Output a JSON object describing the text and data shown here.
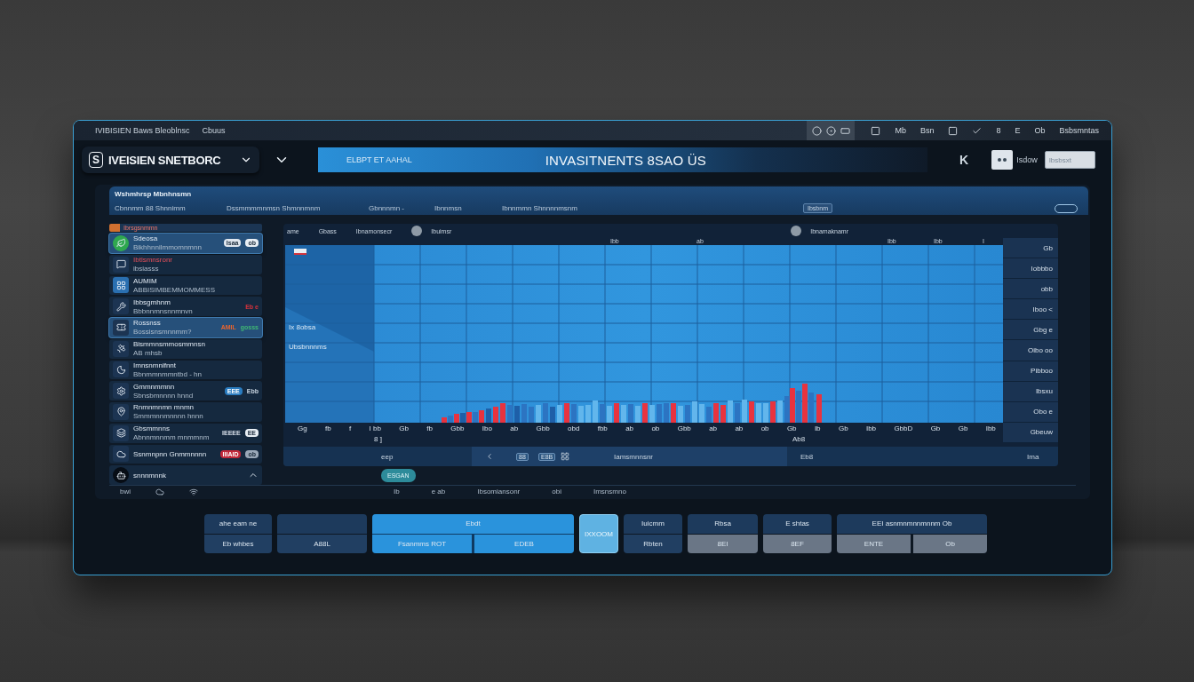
{
  "top_bar": {
    "title": "IVIBISIEN Baws Bleoblnsc",
    "subtitle": "Cbuus",
    "labels": [
      "Mb",
      "Bsn",
      "8",
      "E",
      "Ob",
      "Bsbsmntas"
    ]
  },
  "header": {
    "logo": "S",
    "brand": "IVEISIEN SNETBORC",
    "banner_label": "ELBPT ET AAHAL",
    "title": "INVASITNENTS 8SAO ÜS",
    "shortcut": "K",
    "user_label": "Isdow",
    "search": {
      "value": "Ibsbsxt"
    }
  },
  "sub_bar": {
    "title": "Wshmhrsp Mbnhnsmn",
    "labels": [
      "Cbnnmm 88 Shnnimm",
      "Dssmmmmnmsn Shmnnmnm",
      "Gbnnnmn -",
      "Ibnnmsn",
      "Ibnnmmn Shnnnnmsnm"
    ],
    "chip": "Ibsbnm"
  },
  "sidebar": {
    "header": "Ibrsgsnmmn",
    "items": [
      {
        "kind": "entry",
        "title": "Sdeosa",
        "subtitle": "Bikhhnnilmmomnmnn",
        "selected": true,
        "alert": false,
        "badges": [
          {
            "kind": "pill",
            "text": "Isaa",
            "color": "#dfe6ee"
          },
          {
            "kind": "pill",
            "text": "ob",
            "color": "#e8eef4"
          }
        ]
      },
      {
        "kind": "entry",
        "title": "Ibtlsmnsronr",
        "subtitle": "ibsiasss",
        "selected": false,
        "alert": true
      },
      {
        "kind": "entry",
        "title": "AUMIM",
        "subtitle": "ABBISIMBEMMOMMESS",
        "selected": false,
        "alert": false
      },
      {
        "kind": "entry",
        "title": "Ibbsgmhnm",
        "subtitle": "Bbbnnmnsnnmnvn",
        "selected": false,
        "alert": false,
        "badges": [
          {
            "kind": "text",
            "text": "Eb e",
            "color": "#d8323c"
          }
        ]
      },
      {
        "kind": "entry",
        "title": "Rossnss",
        "subtitle": "Bossisnsmnnmm?",
        "selected": true,
        "alert": false,
        "badges": [
          {
            "kind": "text",
            "text": "AMIL",
            "color": "#e8642e"
          },
          {
            "kind": "text",
            "text": "gosss",
            "color": "#3fb874"
          }
        ]
      },
      {
        "kind": "entry",
        "title": "Bismmnsmmosmmnsn",
        "subtitle": "AB mhsb",
        "selected": false,
        "alert": false
      },
      {
        "kind": "entry",
        "title": "Imnsnmnifnnt",
        "subtitle": "Bbnmmnmmntbd - hn",
        "selected": false,
        "alert": false
      },
      {
        "kind": "entry",
        "title": "Gmmnmmnn",
        "subtitle": "Sbnsbmnnnn hnnd",
        "selected": false,
        "alert": false,
        "badges": [
          {
            "kind": "pill",
            "text": "EEE",
            "color": "#2a7cc0"
          },
          {
            "kind": "text",
            "text": "Ebb",
            "color": "#c8d4e0"
          }
        ]
      },
      {
        "kind": "entry",
        "title": "Rnmnmnmn mnmn",
        "subtitle": "Smmmnnmnnnn hnnn",
        "selected": false,
        "alert": false
      },
      {
        "kind": "entry",
        "title": "Gbsmmnns",
        "subtitle": "Abnnmnnmm mnmmnm",
        "selected": false,
        "alert": false,
        "badges": [
          {
            "kind": "text",
            "text": "IEEEE",
            "color": "#d8e0ea"
          },
          {
            "kind": "pill",
            "text": "EE",
            "color": "#e8eef4"
          }
        ]
      },
      {
        "kind": "entry",
        "title": "Ssnmnpnn Gnmmnnnn",
        "selected": false,
        "alert": false,
        "badges": [
          {
            "kind": "pill",
            "text": "IIIAID",
            "color": "#c0283a"
          },
          {
            "kind": "pill",
            "text": "ob",
            "color": "#9aa8b8"
          }
        ]
      },
      {
        "kind": "group",
        "title": "snnnmnnk",
        "selected": false,
        "alert": false
      }
    ],
    "footer": "bwi"
  },
  "chart": {
    "head": [
      {
        "kind": "plain",
        "text": "ame"
      },
      {
        "kind": "plain",
        "text": "Gbass"
      },
      {
        "kind": "plain",
        "text": "Ibnamonsecr"
      },
      {
        "kind": "dot",
        "text": "Ibuimsr"
      },
      {
        "kind": "dot",
        "text": "Ibnamaknamr"
      }
    ],
    "top_ticks": [
      "Ibb",
      "ab",
      "Ibb",
      "Ibb",
      "I"
    ],
    "notes": [
      "Ix 8obsa",
      "Ubsbnnnms"
    ],
    "x_labels": [
      "Gg",
      "fb",
      "f",
      "I bb",
      "Gb",
      "fb",
      "Gbb",
      "Ibo",
      "ab",
      "Gbb",
      "obd",
      "fbb",
      "ab",
      "ob",
      "Gbb",
      "ab",
      "ab",
      "ob",
      "Gb",
      "Ib",
      "Gb",
      "Ibb",
      "GbbD",
      "Gb",
      "Gb",
      "Ibb"
    ],
    "x_notes": [
      "8 ]",
      "Ab8"
    ],
    "y_labels": [
      "Gb",
      "Iobbbo",
      "obb",
      "Iboo <",
      "Gbg e",
      "Oibo oo",
      "Pibboo",
      "Ibsxu",
      "Obo e",
      "Gbeuw"
    ],
    "foot": {
      "labels": [
        "eep",
        "Iamsmnnsnr",
        "Eb8",
        "Ima"
      ],
      "buttons": [
        "88",
        "E8B"
      ]
    }
  },
  "pill": "ESGAN",
  "status_line": [
    "Ib",
    "e ab",
    "Ibsomiansonr",
    "obi",
    "Imsnsmno"
  ],
  "buttons": [
    {
      "kind": "split",
      "selected": false,
      "top": "ahe eam ne",
      "bottom": [
        "Eb whbes"
      ]
    },
    {
      "kind": "split",
      "selected": false,
      "bottom": [
        "A88L"
      ]
    },
    {
      "kind": "split",
      "selected": true,
      "top": "Ebdt",
      "bottom": [
        "Fsanmms ROT",
        "EDEB"
      ]
    },
    {
      "kind": "single",
      "selected": false,
      "label": "IXXOOM"
    },
    {
      "kind": "split",
      "selected": false,
      "top": "Iuicmm",
      "bottom": [
        "Rbten"
      ]
    },
    {
      "kind": "split-gray",
      "selected": false,
      "top": "Rbsa",
      "bottom": [
        "8EI"
      ]
    },
    {
      "kind": "split-gray",
      "selected": false,
      "top": "E shtas",
      "bottom": [
        "8EF"
      ]
    },
    {
      "kind": "split-gray",
      "selected": false,
      "top": "EEI asnmnmnnmnnm Ob",
      "bottom": [
        "ENTE",
        "Ob"
      ]
    }
  ]
}
